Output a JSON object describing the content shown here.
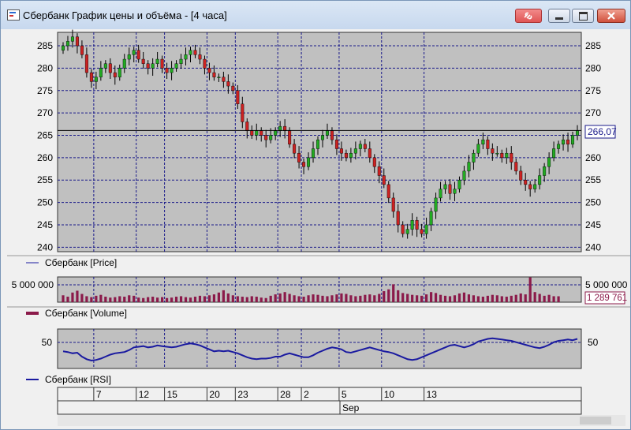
{
  "window": {
    "title": "Сбербанк График цены и объёма - [4 часа]"
  },
  "icons": {
    "app": "chart-window-icon",
    "link": "link-icon",
    "minimize": "minimize-icon",
    "maximize": "maximize-icon",
    "close": "close-icon"
  },
  "colors": {
    "up": "#22aa22",
    "down": "#cc2222",
    "volume": "#8b1a4a",
    "rsi": "#1a1aa0",
    "grid": "#1a1a8a",
    "plot_bg": "#c0c0c0"
  },
  "price_panel": {
    "legend": "Сбербанк [Price]",
    "current_value": "266,07",
    "ticks": [
      "285",
      "280",
      "275",
      "270",
      "265",
      "260",
      "255",
      "250",
      "245",
      "240"
    ]
  },
  "volume_panel": {
    "legend": "Сбербанк [Volume]",
    "tick": "5 000 000",
    "current_value": "1 289 761"
  },
  "rsi_panel": {
    "legend": "Сбербанк [RSI]",
    "tick": "50"
  },
  "x_axis": {
    "days": [
      "7",
      "12",
      "15",
      "20",
      "23",
      "28",
      "2",
      "5",
      "10",
      "13"
    ],
    "month": "Sep"
  },
  "chart_data": [
    {
      "type": "candlestick",
      "name": "Сбербанк [Price]",
      "ylim": [
        239,
        288
      ],
      "last": 266.07,
      "close_points": [
        [
          0,
          285
        ],
        [
          1,
          286
        ],
        [
          2,
          287
        ],
        [
          3,
          285
        ],
        [
          4,
          283
        ],
        [
          5,
          279
        ],
        [
          6,
          277
        ],
        [
          7,
          278
        ],
        [
          8,
          280
        ],
        [
          9,
          281
        ],
        [
          10,
          279
        ],
        [
          11,
          278
        ],
        [
          12,
          280
        ],
        [
          13,
          282
        ],
        [
          14,
          283
        ],
        [
          15,
          284
        ],
        [
          16,
          282
        ],
        [
          17,
          281
        ],
        [
          18,
          280
        ],
        [
          19,
          281
        ],
        [
          20,
          282
        ],
        [
          21,
          280
        ],
        [
          22,
          279
        ],
        [
          23,
          280
        ],
        [
          24,
          281
        ],
        [
          25,
          282
        ],
        [
          26,
          283
        ],
        [
          27,
          284
        ],
        [
          28,
          283
        ],
        [
          29,
          282
        ],
        [
          30,
          280
        ],
        [
          31,
          279
        ],
        [
          32,
          278
        ],
        [
          33,
          278
        ],
        [
          34,
          277
        ],
        [
          35,
          276
        ],
        [
          36,
          275
        ],
        [
          37,
          272
        ],
        [
          38,
          268
        ],
        [
          39,
          266
        ],
        [
          40,
          265
        ],
        [
          41,
          266
        ],
        [
          42,
          265
        ],
        [
          43,
          264
        ],
        [
          44,
          265
        ],
        [
          45,
          266
        ],
        [
          46,
          267
        ],
        [
          47,
          266
        ],
        [
          48,
          263
        ],
        [
          49,
          261
        ],
        [
          50,
          259
        ],
        [
          51,
          258
        ],
        [
          52,
          260
        ],
        [
          53,
          262
        ],
        [
          54,
          264
        ],
        [
          55,
          265
        ],
        [
          56,
          266
        ],
        [
          57,
          264
        ],
        [
          58,
          262
        ],
        [
          59,
          261
        ],
        [
          60,
          260
        ],
        [
          61,
          261
        ],
        [
          62,
          262
        ],
        [
          63,
          263
        ],
        [
          64,
          262
        ],
        [
          65,
          260
        ],
        [
          66,
          258
        ],
        [
          67,
          256
        ],
        [
          68,
          254
        ],
        [
          69,
          251
        ],
        [
          70,
          248
        ],
        [
          71,
          245
        ],
        [
          72,
          243
        ],
        [
          73,
          244
        ],
        [
          74,
          246
        ],
        [
          75,
          244
        ],
        [
          76,
          243
        ],
        [
          77,
          245
        ],
        [
          78,
          248
        ],
        [
          79,
          251
        ],
        [
          80,
          253
        ],
        [
          81,
          254
        ],
        [
          82,
          252
        ],
        [
          83,
          253
        ],
        [
          84,
          255
        ],
        [
          85,
          257
        ],
        [
          86,
          259
        ],
        [
          87,
          261
        ],
        [
          88,
          263
        ],
        [
          89,
          264
        ],
        [
          90,
          262
        ],
        [
          91,
          261
        ],
        [
          92,
          261
        ],
        [
          93,
          260
        ],
        [
          94,
          261
        ],
        [
          95,
          259
        ],
        [
          96,
          257
        ],
        [
          97,
          255
        ],
        [
          98,
          254
        ],
        [
          99,
          253
        ],
        [
          100,
          254
        ],
        [
          101,
          256
        ],
        [
          102,
          258
        ],
        [
          103,
          260
        ],
        [
          104,
          262
        ],
        [
          105,
          263
        ],
        [
          106,
          264
        ],
        [
          107,
          263
        ],
        [
          108,
          265
        ],
        [
          109,
          266.07
        ]
      ]
    },
    {
      "type": "bar",
      "name": "Сбербанк [Volume]",
      "ylim": [
        0,
        5500000
      ],
      "values": [
        1500000,
        1200000,
        2100000,
        2500000,
        1800000,
        1300000,
        1100000,
        1400000,
        1600000,
        1200000,
        1000000,
        1100000,
        1300000,
        1200000,
        1500000,
        1400000,
        1000000,
        900000,
        1100000,
        1200000,
        1000000,
        1100000,
        900000,
        1000000,
        1200000,
        1300000,
        1100000,
        1000000,
        1200000,
        1400000,
        1300000,
        1500000,
        1700000,
        2100000,
        2600000,
        1900000,
        1500000,
        1300000,
        1200000,
        1100000,
        1300000,
        1200000,
        1000000,
        900000,
        1400000,
        1700000,
        1900000,
        2200000,
        1800000,
        1500000,
        1300000,
        1200000,
        1500000,
        1700000,
        1600000,
        1400000,
        1300000,
        1500000,
        1700000,
        1900000,
        1800000,
        1500000,
        1300000,
        1400000,
        1600000,
        1700000,
        1500000,
        1800000,
        2400000,
        2800000,
        3900000,
        2600000,
        2000000,
        1800000,
        1600000,
        1500000,
        1400000,
        1700000,
        2200000,
        2000000,
        1600000,
        1400000,
        1300000,
        1500000,
        1900000,
        2100000,
        1700000,
        1500000,
        1300000,
        1200000,
        1400000,
        1600000,
        1500000,
        1300000,
        1200000,
        1400000,
        1600000,
        1900000,
        1700000,
        5400000,
        2200000,
        1800000,
        1400000,
        1600000,
        1300000,
        1289761
      ]
    },
    {
      "type": "line",
      "name": "Сбербанк [RSI]",
      "ylim": [
        20,
        80
      ],
      "values": [
        46,
        45,
        43,
        44,
        38,
        34,
        32,
        33,
        35,
        38,
        41,
        43,
        44,
        45,
        48,
        52,
        53,
        54,
        52,
        53,
        55,
        54,
        53,
        52,
        53,
        55,
        57,
        58,
        57,
        55,
        52,
        49,
        46,
        47,
        46,
        47,
        45,
        43,
        40,
        37,
        35,
        34,
        35,
        35,
        36,
        38,
        38,
        41,
        43,
        41,
        39,
        37,
        37,
        40,
        44,
        47,
        50,
        52,
        51,
        49,
        45,
        44,
        46,
        48,
        50,
        52,
        50,
        48,
        46,
        45,
        43,
        40,
        37,
        34,
        33,
        34,
        37,
        40,
        43,
        46,
        49,
        52,
        55,
        56,
        54,
        52,
        54,
        57,
        61,
        63,
        65,
        66,
        65,
        64,
        63,
        62,
        60,
        58,
        56,
        54,
        52,
        51,
        53,
        56,
        60,
        62,
        63,
        64,
        63,
        65,
        66
      ]
    }
  ]
}
